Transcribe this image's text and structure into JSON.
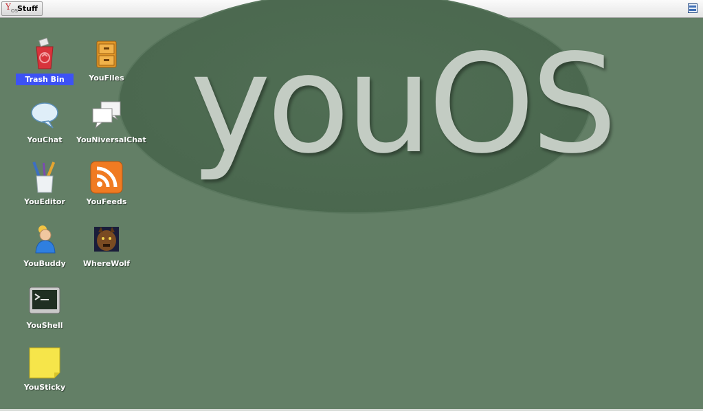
{
  "taskbar": {
    "start_label": "Stuff",
    "logo_letter": "Y",
    "logo_sub": "OS",
    "tray_icon": "desktop-icon"
  },
  "wallpaper": {
    "logo_text": "youOS"
  },
  "desktop_icons": [
    {
      "label": "Trash Bin",
      "icon": "trash-bin-icon",
      "selected": true
    },
    {
      "label": "YouFiles",
      "icon": "file-cabinet-icon"
    },
    {
      "label": "YouChat",
      "icon": "speech-bubble-icon"
    },
    {
      "label": "YouNiversalChat",
      "icon": "chat-bubbles-icon"
    },
    {
      "label": "YouEditor",
      "icon": "pencil-cup-icon"
    },
    {
      "label": "YouFeeds",
      "icon": "rss-icon"
    },
    {
      "label": "YouBuddy",
      "icon": "buddy-icon"
    },
    {
      "label": "WhereWolf",
      "icon": "werewolf-icon"
    },
    {
      "label": "YouShell",
      "icon": "terminal-icon"
    },
    {
      "label": "YouSticky",
      "icon": "sticky-note-icon"
    }
  ],
  "colors": {
    "desktop": "#637f66",
    "wallpaper_ellipse": "#4d6b51",
    "selection": "#3d52f5"
  }
}
